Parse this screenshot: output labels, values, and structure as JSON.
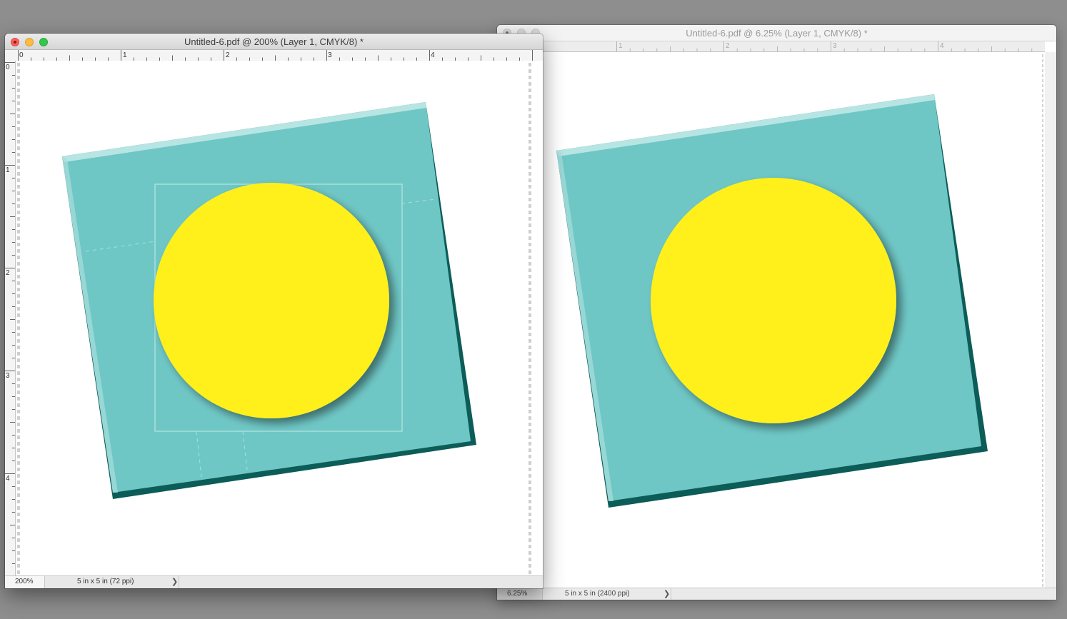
{
  "windows": [
    {
      "title": "Untitled-6.pdf @ 200% (Layer 1, CMYK/8) *",
      "state": "active",
      "ruler_h_labels": [
        "0",
        "1",
        "2",
        "3",
        "4"
      ],
      "ruler_v_labels": [
        "0",
        "1",
        "2",
        "3",
        "4"
      ],
      "zoom": "200%",
      "doc_info": "5 in x 5 in (72 ppi)",
      "doc_arrow": "❯"
    },
    {
      "title": "Untitled-6.pdf @ 6.25% (Layer 1, CMYK/8) *",
      "state": "inactive",
      "ruler_h_labels": [
        "1",
        "2",
        "3",
        "4"
      ],
      "zoom": "6.25%",
      "doc_info": "5 in x 5 in (2400 ppi)",
      "doc_arrow": "❯"
    }
  ],
  "artwork": {
    "square_color": "#6fc7c5",
    "square_bevel_dark": "#0c5c58",
    "square_bevel_light": "#c9ecea",
    "circle_color": "#fff01c",
    "background_color": "#8e8e8e"
  }
}
